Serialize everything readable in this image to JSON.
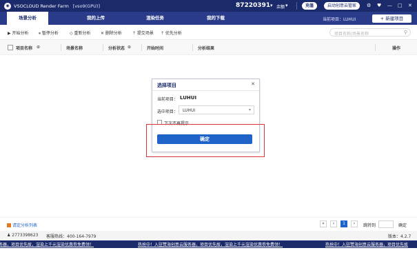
{
  "titlebar": {
    "app_name": "VSOCLOUD Render Farm",
    "version_tag": "[vso9(GPU)]",
    "account_id": "87220391",
    "balance_label": "余额",
    "recharge_label": "充值",
    "manager_label": "启动创意云管家",
    "icons": [
      "gear-icon",
      "heart-icon",
      "minimize-icon",
      "maximize-icon",
      "close-icon"
    ]
  },
  "tabs": [
    {
      "label": "场景分析",
      "active": true
    },
    {
      "label": "我的上传",
      "active": false
    },
    {
      "label": "渲染任务",
      "active": false
    },
    {
      "label": "我的下载",
      "active": false
    }
  ],
  "current_project": "当前项目：LUHUI",
  "new_project_label": "+ 新建项目",
  "toolbar": {
    "start": "▶ 开始分析",
    "pause": "⏸ 暂停分析",
    "restart": "◇ 重新分析",
    "delete": "✕ 删除分析",
    "submit": "⇡ 提交场景",
    "priority": "⇡ 优先分析",
    "search_placeholder": "项目名称/场景名称"
  },
  "columns": {
    "project": "项目名称",
    "scene": "场景名称",
    "status": "分析状态",
    "start_time": "开始时间",
    "result": "分析结果",
    "action": "操作"
  },
  "dialog": {
    "title": "选择项目",
    "current_label": "当前项目：",
    "current_value": "LUHUI",
    "select_label": "选中项目：",
    "select_value": "LUHUI",
    "dont_remind": "下次不再提示",
    "confirm": "确定"
  },
  "pager": {
    "refresh": "请定分析列表",
    "first": "«",
    "prev": "‹",
    "page": "1",
    "next": "›",
    "last": "»",
    "jump_label": "跳转到",
    "confirm": "确定"
  },
  "footer": {
    "qq": "2773398623",
    "hotline": "客服热线：400-164-7979",
    "version": "版本：4.2.7"
  },
  "ticker": [
    "务器，项目优先故，渲染上千元渲染优惠劵免费领！",
    "热抢中！入驻赞海创意云服务器，项目优先故，渲染上千元渲染优惠劵免费领！",
    "热抢中！入驻赞海创意云服务器，项目优先故"
  ],
  "colors": {
    "titlebar": "#1b2a6b",
    "tabbar": "#2a3b8a",
    "accent": "#1e64c8",
    "highlight": "#d9343a"
  }
}
